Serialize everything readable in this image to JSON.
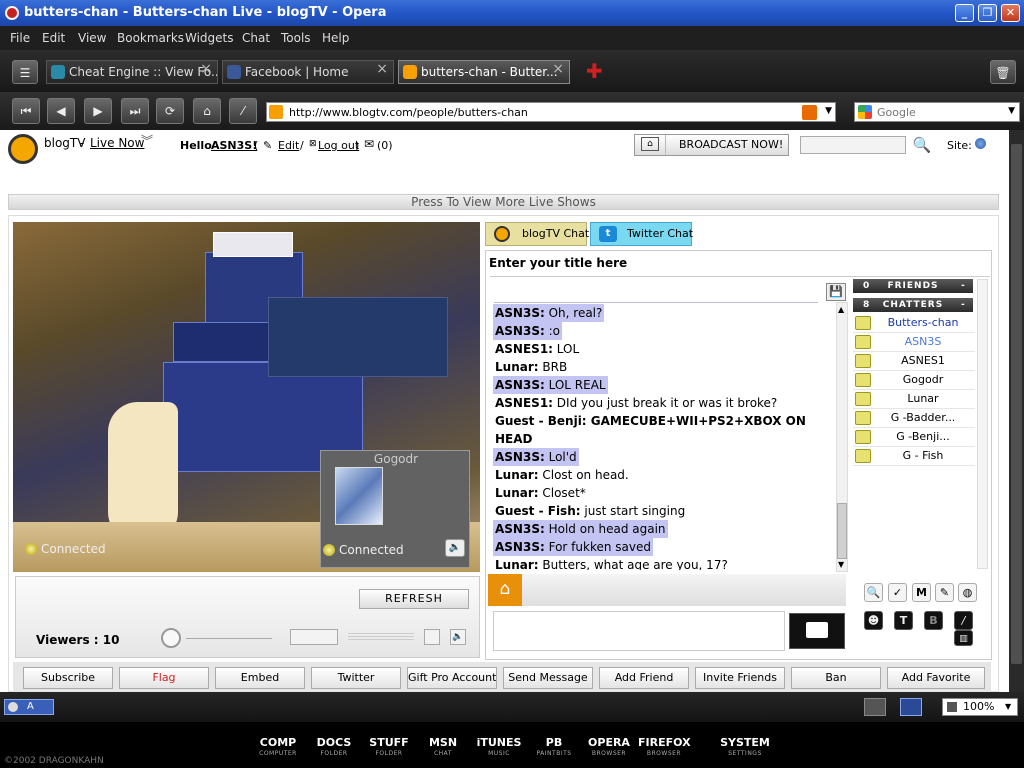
{
  "window": {
    "title": "butters-chan - Butters-chan Live - blogTV - Opera"
  },
  "menu": [
    "File",
    "Edit",
    "View",
    "Bookmarks",
    "Widgets",
    "Chat",
    "Tools",
    "Help"
  ],
  "tabs": [
    {
      "label": "Cheat Engine :: View Fo...",
      "active": false
    },
    {
      "label": "Facebook | Home",
      "active": false
    },
    {
      "label": "butters-chan - Butter...",
      "active": true
    }
  ],
  "nav": {
    "url": "http://www.blogtv.com/people/butters-chan",
    "search_placeholder": "Google"
  },
  "header": {
    "brand": "blogTV",
    "separator": " - ",
    "live_now": "Live Now",
    "hello": "Hello",
    "username": "ASN3S!",
    "paren_open": "(",
    "edit": "Edit",
    "slash": "/",
    "logout": "Log out",
    "paren_close": ")",
    "messages_count": "(0)",
    "broadcast": "BROADCAST NOW!",
    "site_label": "Site:"
  },
  "more_live": "Press To View More Live Shows",
  "video": {
    "main_status": "Connected",
    "pip_name": "Gogodr",
    "pip_status": "Connected",
    "refresh": "REFRESH",
    "viewers": "Viewers : 10"
  },
  "chat": {
    "tab_blogtv": "blogTV Chat",
    "tab_twitter": "Twitter Chat",
    "title": "Enter your title here",
    "messages": [
      {
        "user": "ASN3S:",
        "text": "Oh, real?",
        "hl": true
      },
      {
        "user": "ASN3S:",
        "text": ":o",
        "hl": true
      },
      {
        "user": "ASNES1:",
        "text": "LOL",
        "hl": false
      },
      {
        "user": "Lunar:",
        "text": "BRB",
        "hl": false
      },
      {
        "user": "ASN3S:",
        "text": "LOL REAL",
        "hl": true
      },
      {
        "user": "ASNES1:",
        "text": "DId you just break it or was it broke?",
        "hl": false
      },
      {
        "user": "Guest - Benji:",
        "text": "GAMECUBE+WII+PS2+XBOX ON HEAD",
        "hl": false,
        "bold": true
      },
      {
        "user": "ASN3S:",
        "text": "Lol'd",
        "hl": true
      },
      {
        "user": "Lunar:",
        "text": "Clost on head.",
        "hl": false
      },
      {
        "user": "Lunar:",
        "text": "Closet*",
        "hl": false
      },
      {
        "user": "Guest - Fish:",
        "text": "just start singing",
        "hl": false
      },
      {
        "user": "ASN3S:",
        "text": "Hold on head again",
        "hl": true
      },
      {
        "user": "ASN3S:",
        "text": "For fukken saved",
        "hl": true
      },
      {
        "user": "Lunar:",
        "text": "Butters, what age are you, 17?",
        "hl": false
      }
    ],
    "friends_count": "0",
    "friends_label": "FRIENDS",
    "chatters_count": "8",
    "chatters_label": "CHATTERS",
    "collapse": "-",
    "users": [
      {
        "name": "Butters-chan",
        "color": "#1a3aa8"
      },
      {
        "name": "ASN3S",
        "color": "#4a7ad8"
      },
      {
        "name": "ASNES1",
        "color": "#222222"
      },
      {
        "name": "Gogodr",
        "color": "#222222"
      },
      {
        "name": "Lunar",
        "color": "#222222"
      },
      {
        "name": "G -Badder...",
        "color": "#222222"
      },
      {
        "name": "G -Benji...",
        "color": "#222222"
      },
      {
        "name": "G - Fish",
        "color": "#222222"
      }
    ]
  },
  "actions": [
    "Subscribe",
    "Flag",
    "Embed",
    "Twitter",
    "Gift Pro Account",
    "Send Message",
    "Add Friend",
    "Invite Friends",
    "Ban",
    "Add Favorite"
  ],
  "status": {
    "zoom": "100%",
    "indicator": "A"
  },
  "taskbar": {
    "copyright": "©2002 DRAGONKAHN",
    "items": [
      {
        "main": "COMP",
        "sub": "COMPUTER"
      },
      {
        "main": "DOCS",
        "sub": "FOLDER"
      },
      {
        "main": "STUFF",
        "sub": "FOLDER"
      },
      {
        "main": "MSN",
        "sub": "CHAT"
      },
      {
        "main": "iTUNES",
        "sub": "MUSIC"
      },
      {
        "main": "PB",
        "sub": "PAINTBITS"
      },
      {
        "main": "OPERA",
        "sub": "BROWSER"
      },
      {
        "main": "FIREFOX",
        "sub": "BROWSER"
      },
      {
        "main": "SYSTEM",
        "sub": "SETTINGS"
      }
    ]
  },
  "colors": {
    "highlight": "#c4c4f2",
    "accent": "#e8900a",
    "titlebar": "#2456c7"
  }
}
